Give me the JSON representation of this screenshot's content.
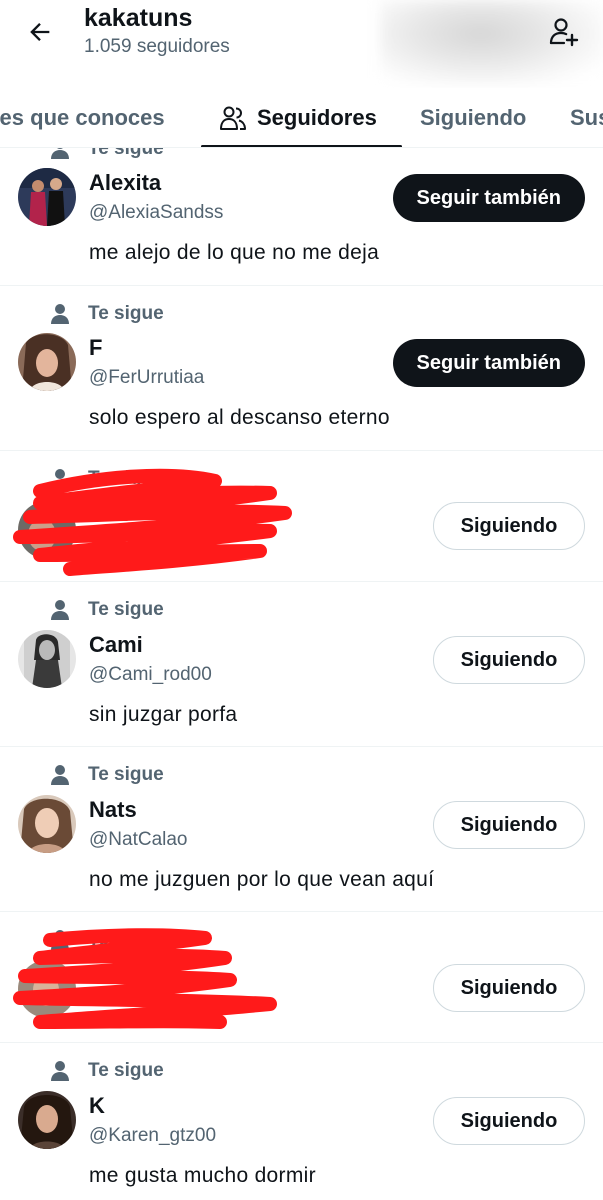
{
  "header": {
    "title": "kakatuns",
    "followers_count": "1.059 seguidores",
    "back_icon": "arrow-left-icon",
    "add_icon": "person-plus-icon"
  },
  "tabs": [
    {
      "label": "res que conoces",
      "active": false
    },
    {
      "label": "Seguidores",
      "active": true
    },
    {
      "label": "Siguiendo",
      "active": false
    },
    {
      "label": "Sus",
      "active": false
    }
  ],
  "follows_you_label": "Te sigue",
  "colors": {
    "text": "#0f1419",
    "secondary": "#536471",
    "border": "#cfd9de",
    "divider": "#eff3f4",
    "redaction": "#ff1a1a"
  },
  "users": [
    {
      "name": "Alexita",
      "handle": "@AlexiaSandss",
      "bio": "me alejo de lo que no me deja",
      "button": "Seguir también",
      "following": false
    },
    {
      "name": "F",
      "handle": "@FerUrrutiaa",
      "bio": "solo espero al descanso eterno",
      "button": "Seguir también",
      "following": false
    },
    {
      "name": "",
      "handle": "",
      "bio": "",
      "button": "Siguiendo",
      "following": true,
      "redacted": true
    },
    {
      "name": "Cami",
      "handle": "@Cami_rod00",
      "bio": "sin juzgar porfa",
      "button": "Siguiendo",
      "following": true
    },
    {
      "name": "Nats",
      "handle": "@NatCalao",
      "bio": "no me juzguen por lo que vean aquí",
      "button": "Siguiendo",
      "following": true
    },
    {
      "name": "",
      "handle": "",
      "bio": "",
      "button": "Siguiendo",
      "following": true,
      "redacted": true
    },
    {
      "name": "K",
      "handle": "@Karen_gtz00",
      "bio": "me gusta mucho dormir",
      "button": "Siguiendo",
      "following": true
    }
  ]
}
